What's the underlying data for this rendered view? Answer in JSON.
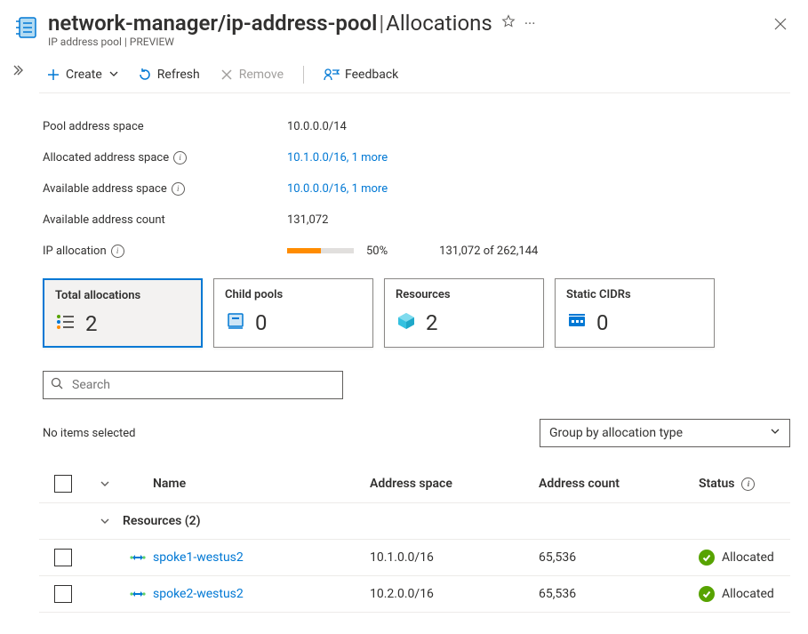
{
  "header": {
    "title_prefix": "network-manager/ip-address-pool",
    "title_suffix": "Allocations",
    "subtitle": "IP address pool | PREVIEW"
  },
  "toolbar": {
    "create": "Create",
    "refresh": "Refresh",
    "remove": "Remove",
    "feedback": "Feedback"
  },
  "essentials": {
    "pool_address_space": {
      "label": "Pool address space",
      "value": "10.0.0.0/14"
    },
    "allocated_space": {
      "label": "Allocated address space",
      "value": "10.1.0.0/16, 1 more"
    },
    "available_space": {
      "label": "Available address space",
      "value": "10.0.0.0/16, 1 more"
    },
    "available_count": {
      "label": "Available address count",
      "value": "131,072"
    },
    "ip_allocation": {
      "label": "IP allocation",
      "percent_label": "50%",
      "percent": 50,
      "ratio": "131,072 of 262,144"
    }
  },
  "cards": {
    "total": {
      "title": "Total allocations",
      "value": "2"
    },
    "child": {
      "title": "Child pools",
      "value": "0"
    },
    "res": {
      "title": "Resources",
      "value": "2"
    },
    "static": {
      "title": "Static CIDRs",
      "value": "0"
    }
  },
  "search": {
    "placeholder": "Search"
  },
  "list": {
    "no_items": "No items selected",
    "group_by": "Group by allocation type",
    "cols": {
      "name": "Name",
      "address_space": "Address space",
      "address_count": "Address count",
      "status": "Status"
    },
    "group_label": "Resources (2)",
    "rows": [
      {
        "name": "spoke1-westus2",
        "address_space": "10.1.0.0/16",
        "address_count": "65,536",
        "status": "Allocated"
      },
      {
        "name": "spoke2-westus2",
        "address_space": "10.2.0.0/16",
        "address_count": "65,536",
        "status": "Allocated"
      }
    ]
  }
}
